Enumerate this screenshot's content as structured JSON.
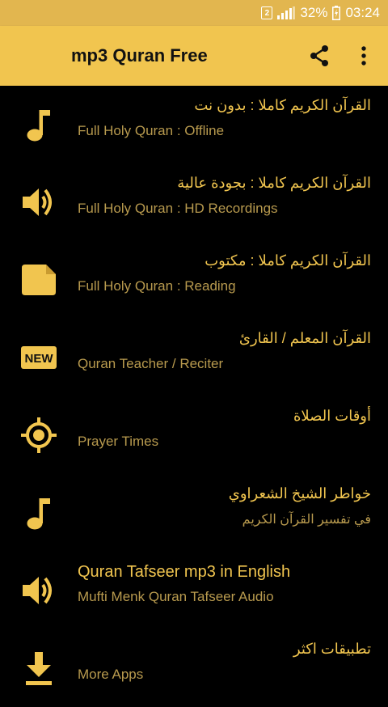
{
  "status_bar": {
    "sim": "2",
    "battery": "32%",
    "time": "03:24"
  },
  "app_bar": {
    "title": "mp3 Quran Free"
  },
  "items": [
    {
      "icon": "music-note-icon",
      "title": "القرآن الكريم كاملا : بدون نت",
      "subtitle": "Full Holy Quran : Offline"
    },
    {
      "icon": "speaker-icon",
      "title": "القرآن الكريم كاملا : بجودة عالية",
      "subtitle": "Full Holy Quran : HD Recordings"
    },
    {
      "icon": "document-icon",
      "title": "القرآن الكريم كاملا : مكتوب",
      "subtitle": "Full Holy Quran : Reading"
    },
    {
      "icon": "new-badge-icon",
      "badge": "NEW",
      "title": "القرآن المعلم / القارئ",
      "subtitle": "Quran Teacher / Reciter"
    },
    {
      "icon": "gps-target-icon",
      "title": "أوقات الصلاة",
      "subtitle": "Prayer Times"
    },
    {
      "icon": "music-note-icon",
      "title": "خواطر الشيخ الشعراوي",
      "subtitle": "في تفسير القرآن الكريم"
    },
    {
      "icon": "speaker-icon",
      "title": "Quran Tafseer mp3 in English",
      "subtitle": "Mufti Menk Quran Tafseer Audio"
    },
    {
      "icon": "download-icon",
      "title": "تطبيقات اكثر",
      "subtitle": "More Apps"
    }
  ],
  "colors": {
    "accent": "#f1c54f",
    "status_bar": "#e2b64f",
    "background": "#000000",
    "subtitle": "#b89a4e"
  }
}
